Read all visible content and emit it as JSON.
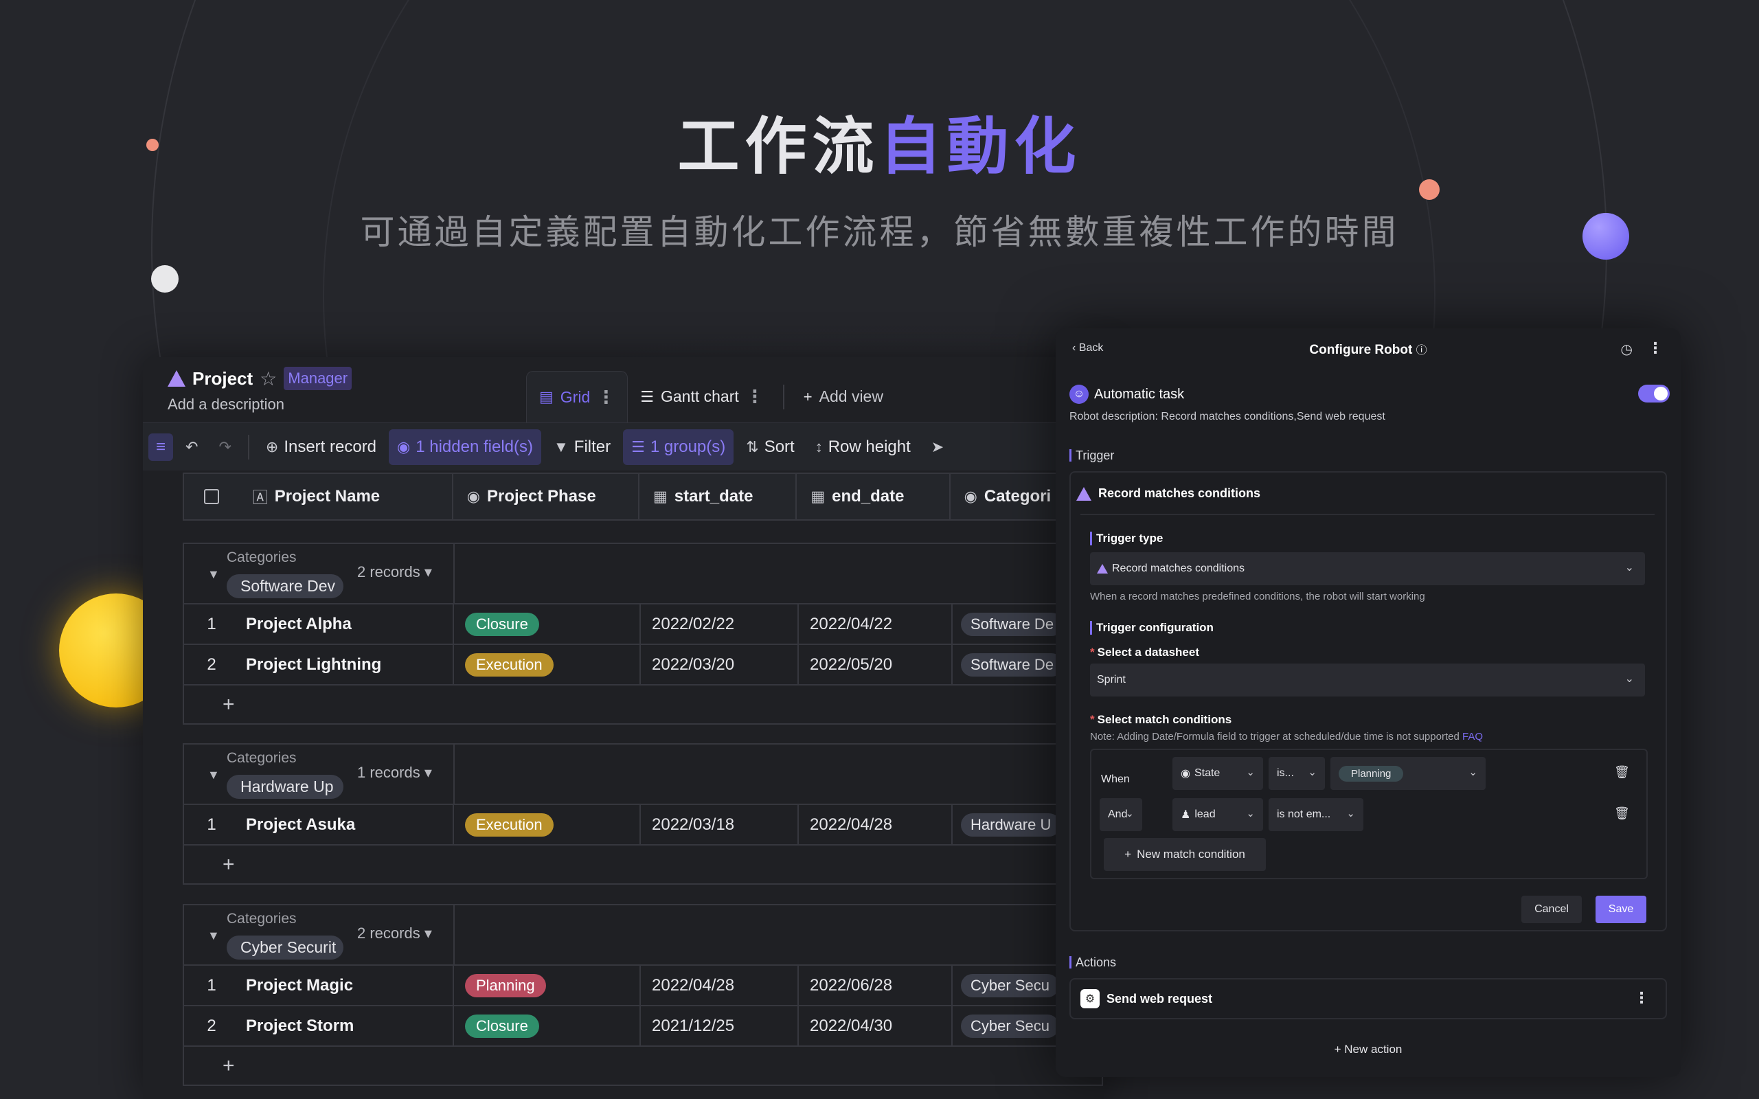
{
  "hero": {
    "title_plain": "工作流",
    "title_accent": "自動化",
    "subtitle": "可通過自定義配置自動化工作流程，節省無數重複性工作的時間"
  },
  "colors": {
    "accent": "#7c6cf2",
    "background": "#25262b",
    "closure": "#2f8f6b",
    "execution": "#b8902a",
    "planning": "#b84a5e"
  },
  "app": {
    "project_title": "Project",
    "role_badge": "Manager",
    "description": "Add a description",
    "views": [
      {
        "label": "Grid",
        "icon": "grid-icon",
        "active": true
      },
      {
        "label": "Gantt chart",
        "icon": "gantt-icon",
        "active": false
      }
    ],
    "add_view": "Add view",
    "toolbar": {
      "insert_record": "Insert record",
      "hidden_fields": "1 hidden field(s)",
      "filter": "Filter",
      "groups": "1 group(s)",
      "sort": "Sort",
      "row_height": "Row height"
    },
    "columns": [
      "Project Name",
      "Project Phase",
      "start_date",
      "end_date",
      "Categori"
    ],
    "groups": [
      {
        "label": "Categories",
        "value": "Software Dev",
        "count": "2 records ▾",
        "rows": [
          {
            "n": "1",
            "name": "Project Alpha",
            "phase": "Closure",
            "start": "2022/02/22",
            "end": "2022/04/22",
            "cat": "Software De"
          },
          {
            "n": "2",
            "name": "Project Lightning",
            "phase": "Execution",
            "start": "2022/03/20",
            "end": "2022/05/20",
            "cat": "Software De"
          }
        ]
      },
      {
        "label": "Categories",
        "value": "Hardware Up",
        "count": "1 records ▾",
        "rows": [
          {
            "n": "1",
            "name": "Project Asuka",
            "phase": "Execution",
            "start": "2022/03/18",
            "end": "2022/04/28",
            "cat": "Hardware U"
          }
        ]
      },
      {
        "label": "Categories",
        "value": "Cyber Securit",
        "count": "2 records ▾",
        "rows": [
          {
            "n": "1",
            "name": "Project Magic",
            "phase": "Planning",
            "start": "2022/04/28",
            "end": "2022/06/28",
            "cat": "Cyber Secu"
          },
          {
            "n": "2",
            "name": "Project Storm",
            "phase": "Closure",
            "start": "2021/12/25",
            "end": "2022/04/30",
            "cat": "Cyber Secu"
          }
        ]
      }
    ]
  },
  "robot": {
    "back": "Back",
    "title": "Configure Robot",
    "name": "Automatic task",
    "enabled": true,
    "description": "Robot description: Record matches conditions,Send web request",
    "trigger_section": "Trigger",
    "trigger_name": "Record matches conditions",
    "trigger_type_label": "Trigger type",
    "trigger_type_value": "Record matches conditions",
    "trigger_hint": "When a record matches predefined conditions, the robot will start working",
    "trigger_config_label": "Trigger configuration",
    "datasheet_label": "Select a datasheet",
    "datasheet_value": "Sprint",
    "conditions_label": "Select match conditions",
    "conditions_note": "Note: Adding Date/Formula field to trigger at scheduled/due time is not supported",
    "faq": "FAQ",
    "conditions": [
      {
        "joiner": "When",
        "field": "State",
        "op": "is...",
        "value": "Planning"
      },
      {
        "joiner": "And",
        "field": "lead",
        "op": "is not em...",
        "value": ""
      }
    ],
    "new_condition": "New match condition",
    "cancel": "Cancel",
    "save": "Save",
    "actions_section": "Actions",
    "action_name": "Send web request",
    "new_action": "New action"
  }
}
